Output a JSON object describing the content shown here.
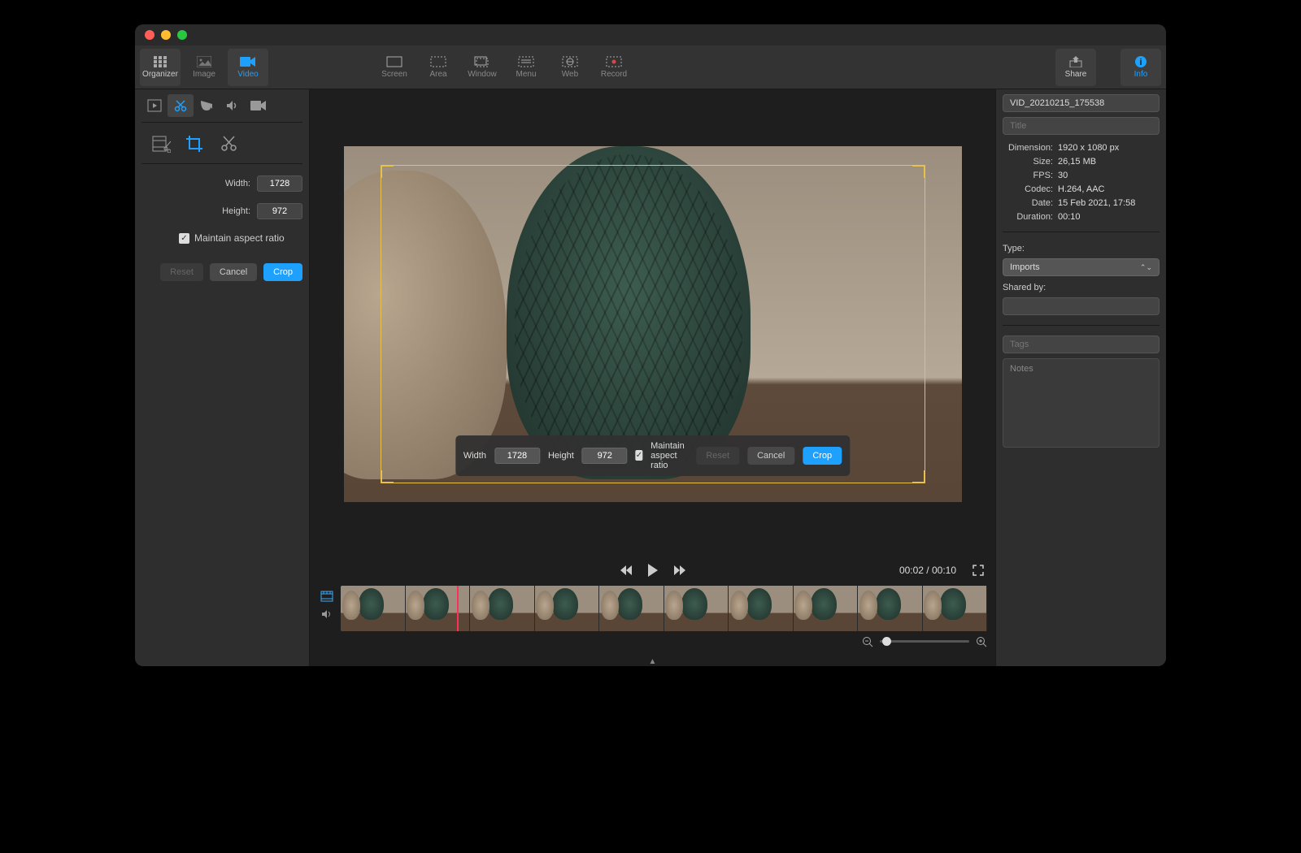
{
  "toolbar": {
    "left": [
      {
        "label": "Organizer",
        "icon": "grid"
      },
      {
        "label": "Image",
        "icon": "image"
      },
      {
        "label": "Video",
        "icon": "vidcam"
      }
    ],
    "center": [
      {
        "label": "Screen",
        "icon": "screen"
      },
      {
        "label": "Area",
        "icon": "area"
      },
      {
        "label": "Window",
        "icon": "window"
      },
      {
        "label": "Menu",
        "icon": "menu"
      },
      {
        "label": "Web",
        "icon": "web"
      },
      {
        "label": "Record",
        "icon": "rec"
      }
    ],
    "right": [
      {
        "label": "Share",
        "icon": "share"
      },
      {
        "label": "Info",
        "icon": "info"
      }
    ]
  },
  "left": {
    "width_label": "Width:",
    "height_label": "Height:",
    "width": "1728",
    "height": "972",
    "maintain": "Maintain aspect ratio",
    "reset": "Reset",
    "cancel": "Cancel",
    "crop": "Crop"
  },
  "overlay": {
    "width_label": "Width",
    "height_label": "Height",
    "width": "1728",
    "height": "972",
    "maintain": "Maintain aspect ratio",
    "reset": "Reset",
    "cancel": "Cancel",
    "crop": "Crop"
  },
  "player": {
    "time": "00:02 / 00:10"
  },
  "right": {
    "filename": "VID_20210215_175538",
    "title_placeholder": "Title",
    "dimension_k": "Dimension:",
    "dimension": "1920 x 1080 px",
    "size_k": "Size:",
    "size": "26,15 MB",
    "fps_k": "FPS:",
    "fps": "30",
    "codec_k": "Codec:",
    "codec": "H.264, AAC",
    "date_k": "Date:",
    "date": "15 Feb 2021, 17:58",
    "duration_k": "Duration:",
    "duration": "00:10",
    "type_label": "Type:",
    "type_value": "Imports",
    "shared_label": "Shared by:",
    "tags_placeholder": "Tags",
    "notes_placeholder": "Notes"
  }
}
